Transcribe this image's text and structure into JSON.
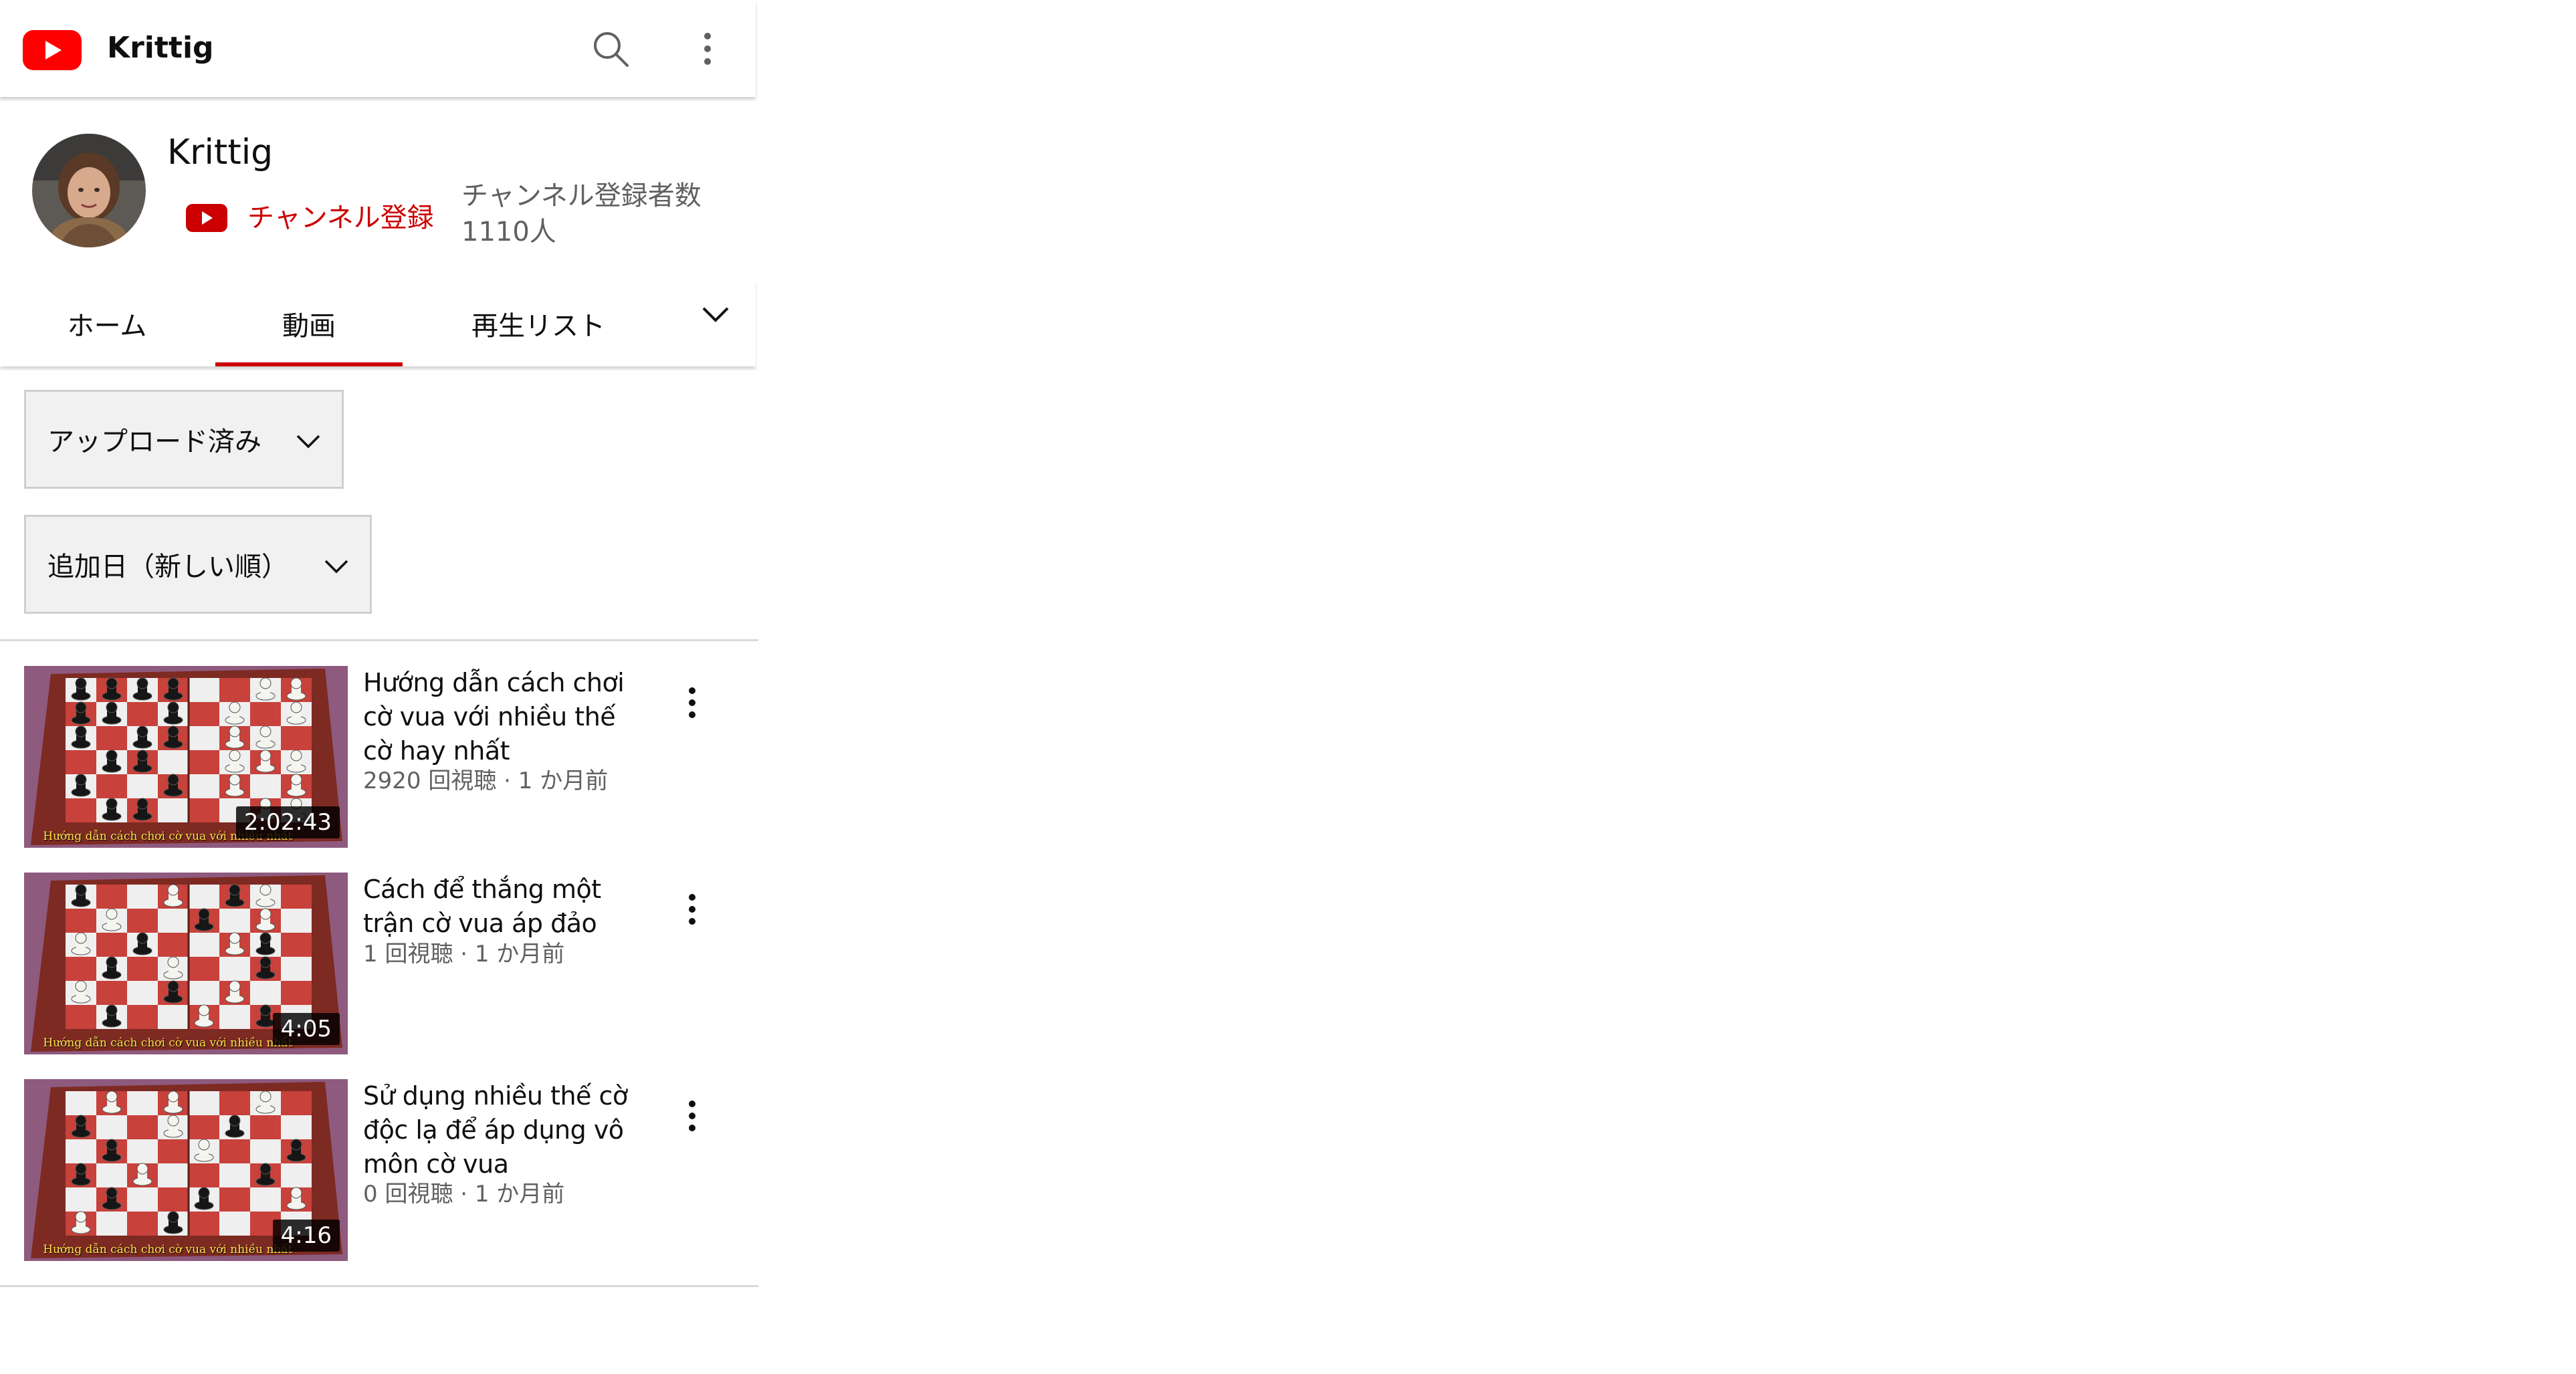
{
  "colors": {
    "brand_red": "#ff0000",
    "accent_red": "#cc0000",
    "text_primary": "#0f0f0f",
    "text_secondary": "#606060"
  },
  "topbar": {
    "title": "Krittig",
    "icons": [
      "youtube-logo-icon",
      "search-icon",
      "more-vert-icon"
    ]
  },
  "channel": {
    "name": "Krittig",
    "subscribe_label": "チャンネル登録",
    "subscriber_count": "チャンネル登録者数 1110人"
  },
  "tabs": [
    {
      "label": "ホーム",
      "selected": false
    },
    {
      "label": "動画",
      "selected": true
    },
    {
      "label": "再生リスト",
      "selected": false
    }
  ],
  "filters": {
    "upload_filter": "アップロード済み",
    "sort_filter": "追加日（新しい順）"
  },
  "videos": [
    {
      "title": "Hướng dẫn cách chơi cờ vua với nhiều thế cờ hay nhất",
      "meta": "2920 回視聴 · 1 か月前",
      "duration": "2:02:43",
      "thumb_caption": "Hướng dẫn cách chơi cờ vua với nhiều nhất"
    },
    {
      "title": "Cách để thắng một trận cờ vua áp đảo",
      "meta": "1 回視聴 · 1 か月前",
      "duration": "4:05",
      "thumb_caption": "Hướng dẫn cách chơi cờ vua với nhiều nhất"
    },
    {
      "title": "Sử dụng nhiều thế cờ độc lạ để áp dụng vô môn cờ vua",
      "meta": "0 回視聴 · 1 か月前",
      "duration": "4:16",
      "thumb_caption": "Hướng dẫn cách chơi cờ vua với nhiều nhất"
    }
  ]
}
